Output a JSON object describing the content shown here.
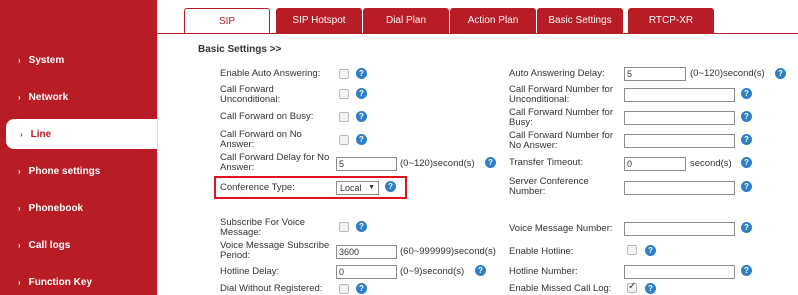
{
  "sidebar": {
    "items": [
      {
        "label": "System"
      },
      {
        "label": "Network"
      },
      {
        "label": "Line"
      },
      {
        "label": "Phone settings"
      },
      {
        "label": "Phonebook"
      },
      {
        "label": "Call logs"
      },
      {
        "label": "Function Key"
      }
    ],
    "arrow": "›"
  },
  "tabs": [
    {
      "label": "SIP"
    },
    {
      "label": "SIP Hotspot"
    },
    {
      "label": "Dial Plan"
    },
    {
      "label": "Action Plan"
    },
    {
      "label": "Basic Settings"
    },
    {
      "label": "RTCP-XR"
    }
  ],
  "section_title": "Basic Settings >>",
  "help_glyph": "?",
  "left": {
    "enable_auto_answering": "Enable Auto Answering:",
    "cf_unconditional": "Call Forward\nUnconditional:",
    "cf_busy": "Call Forward on Busy:",
    "cf_no_answer": "Call Forward on No\nAnswer:",
    "cf_delay_label": "Call Forward Delay for No\nAnswer:",
    "cf_delay_value": "5",
    "cf_delay_unit": "(0~120)second(s)",
    "conference_type_label": "Conference Type:",
    "conference_type_value": "Local",
    "subscribe_voice_label": "Subscribe For Voice\nMessage:",
    "vm_period_label": "Voice Message Subscribe\nPeriod:",
    "vm_period_value": "3600",
    "vm_period_unit": "(60~999999)second(s)",
    "hotline_delay_label": "Hotline Delay:",
    "hotline_delay_value": "0",
    "hotline_delay_unit": "(0~9)second(s)",
    "dial_without_registered": "Dial Without Registered:"
  },
  "right": {
    "auto_answering_delay_label": "Auto Answering Delay:",
    "auto_answering_delay_value": "5",
    "auto_answering_delay_unit": "(0~120)second(s)",
    "cf_number_unconditional": "Call Forward Number for\nUnconditional:",
    "cf_number_busy": "Call Forward Number for\nBusy:",
    "cf_number_no_answer": "Call Forward Number for\nNo Answer:",
    "transfer_timeout_label": "Transfer Timeout:",
    "transfer_timeout_value": "0",
    "transfer_timeout_unit": "second(s)",
    "server_conference_number": "Server Conference\nNumber:",
    "voice_message_number": "Voice Message Number:",
    "enable_hotline": "Enable Hotline:",
    "hotline_number": "Hotline Number:",
    "enable_missed_call_log": "Enable Missed Call Log:"
  },
  "colors": {
    "brand": "#b81c25",
    "help": "#2f7fc8",
    "highlight": "#e0141e"
  }
}
